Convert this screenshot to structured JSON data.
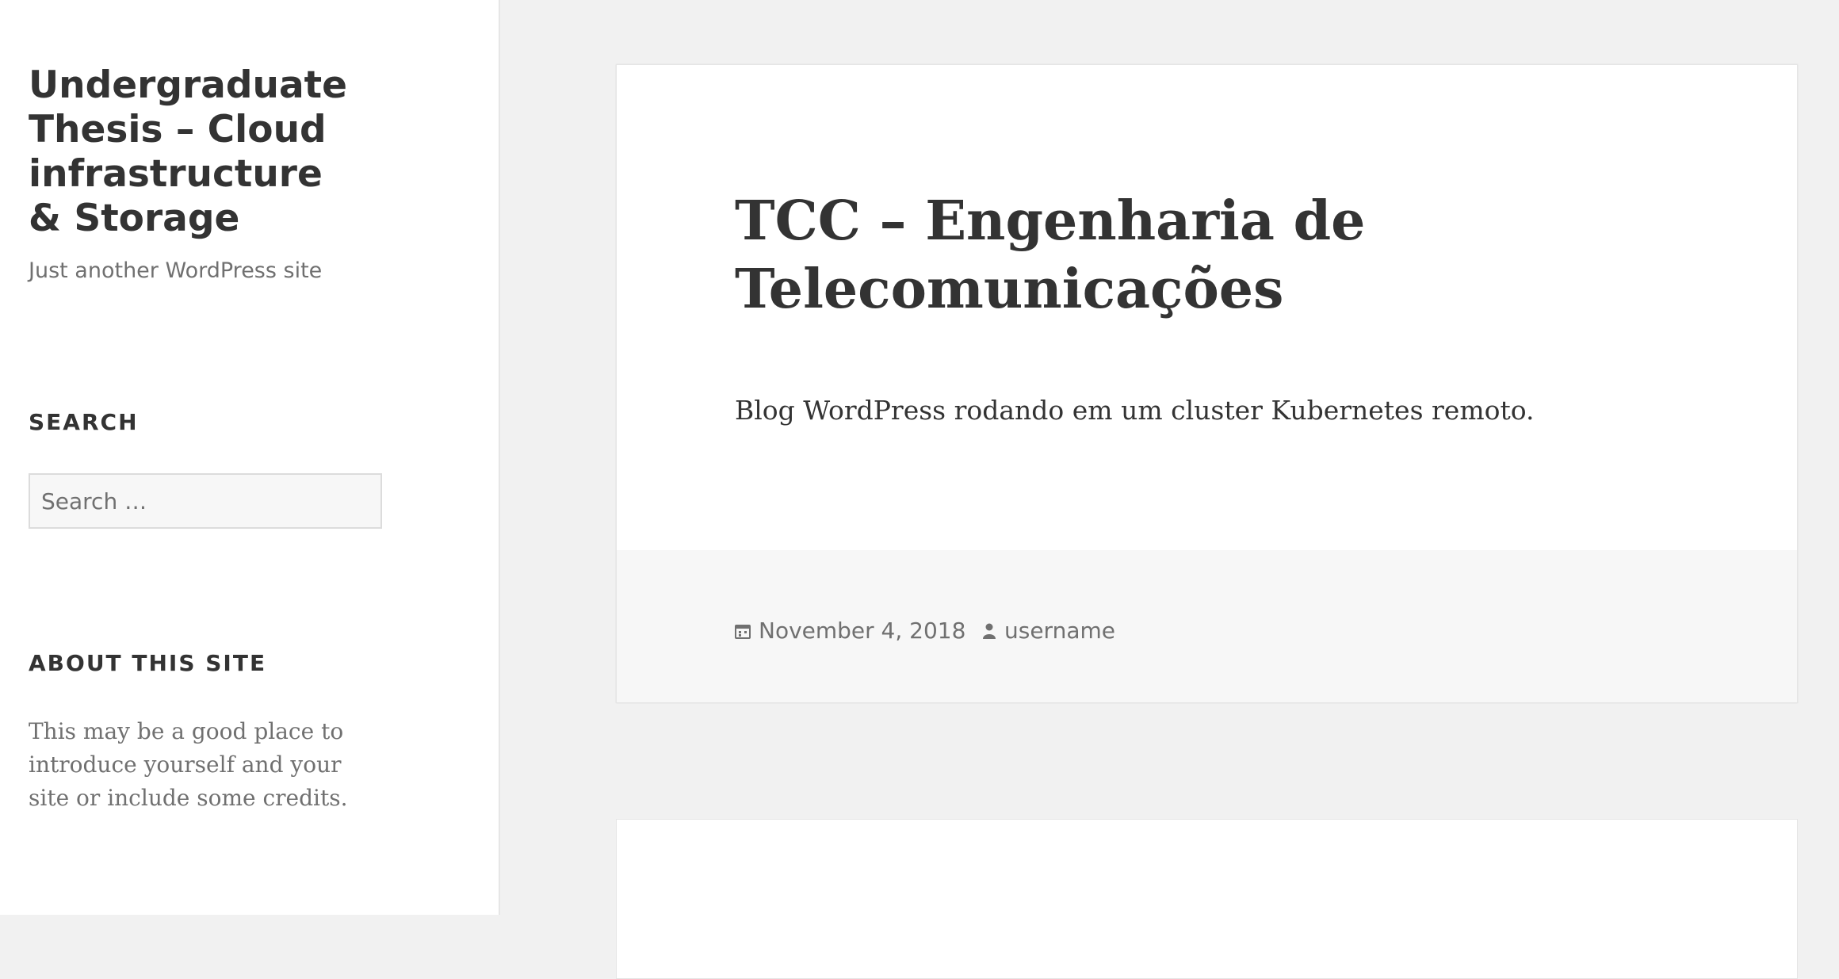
{
  "site": {
    "title": "Undergraduate Thesis – Cloud infrastructure & Storage",
    "tagline": "Just another WordPress site"
  },
  "widgets": {
    "search": {
      "title": "SEARCH",
      "placeholder": "Search …",
      "value": ""
    },
    "about": {
      "title": "ABOUT THIS SITE",
      "text": "This may be a good place to introduce yourself and your site or include some credits."
    }
  },
  "post": {
    "title": "TCC – Engenharia de Telecomunicações",
    "excerpt": "Blog WordPress rodando em um cluster Kubernetes remoto.",
    "date": "November 4, 2018",
    "author": "username",
    "date_icon": "calendar-icon",
    "author_icon": "user-icon"
  },
  "colors": {
    "background": "#f1f1f1",
    "sidebar": "#ffffff",
    "text": "#333333",
    "muted": "#707070",
    "footer": "#f7f7f7"
  }
}
